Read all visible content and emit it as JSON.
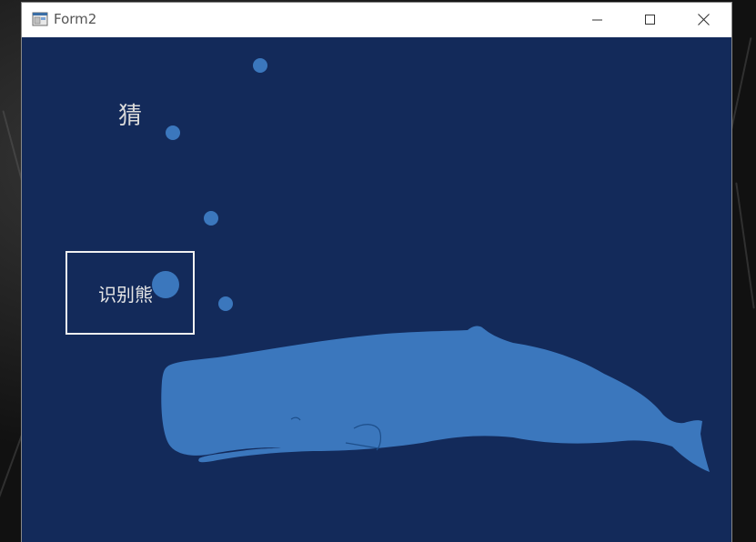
{
  "window": {
    "title": "Form2",
    "icon": "app-form-icon",
    "controls": {
      "minimize": "minimize-icon",
      "maximize": "maximize-icon",
      "close": "close-icon"
    }
  },
  "client": {
    "background_color": "#132a5a",
    "accent_color": "#3b77bd",
    "hint_label": "猜",
    "identify_button_label": "识别熊",
    "illustration": "sperm-whale-with-bubbles"
  }
}
